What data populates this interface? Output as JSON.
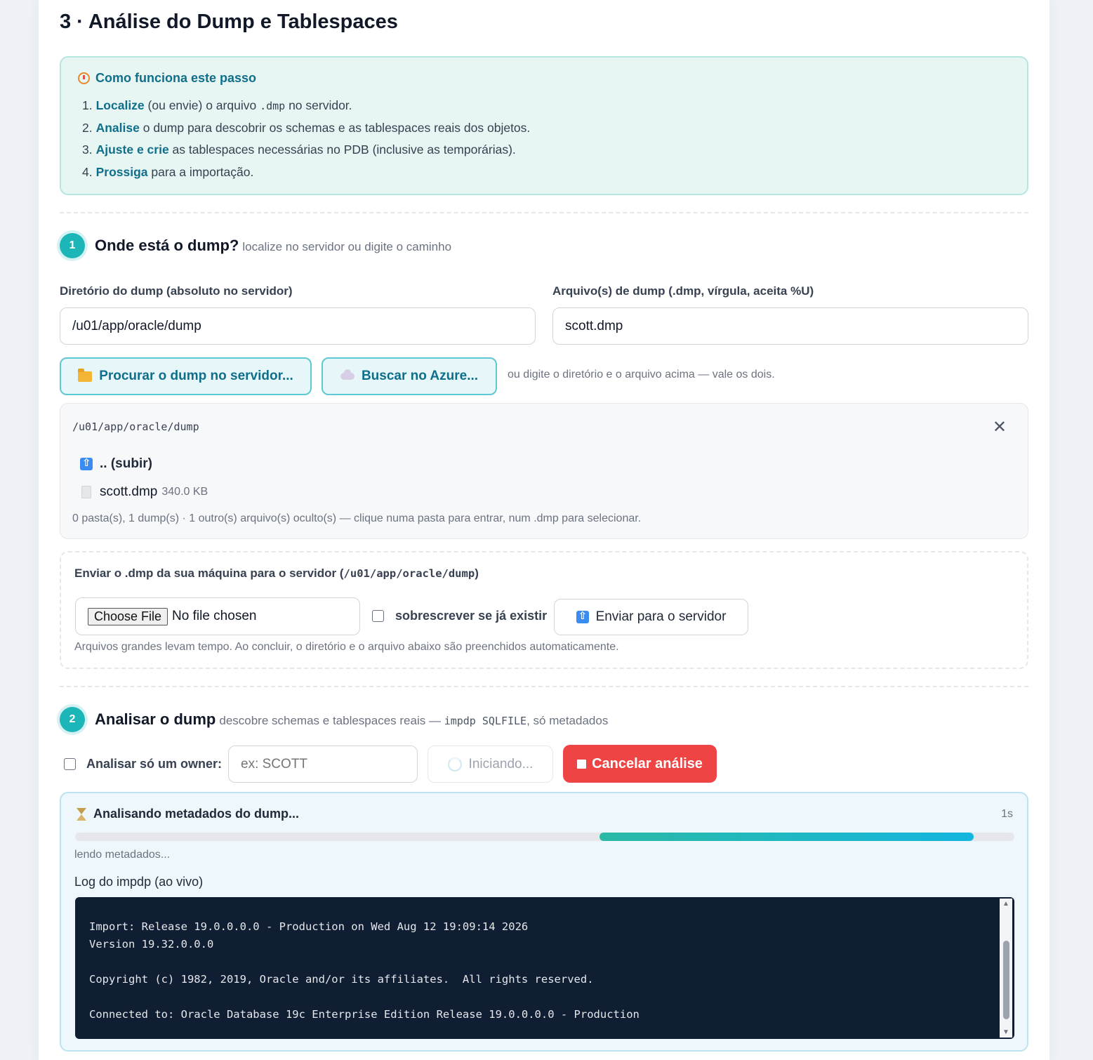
{
  "page": {
    "title": "3 · Análise do Dump e Tablespaces"
  },
  "info": {
    "title": "Como funciona este passo",
    "steps": [
      {
        "num": "1.",
        "keyword": "Localize",
        "text_a": " (ou envie) o arquivo ",
        "code": ".dmp",
        "text_b": " no servidor."
      },
      {
        "num": "2.",
        "keyword": "Analise",
        "text": " o dump para descobrir os schemas e as tablespaces reais dos objetos."
      },
      {
        "num": "3.",
        "keyword": "Ajuste e crie",
        "text": " as tablespaces necessárias no PDB (inclusive as temporárias)."
      },
      {
        "num": "4.",
        "keyword": "Prossiga",
        "text": " para a importação."
      }
    ]
  },
  "step1": {
    "badge": "1",
    "title": "Onde está o dump?",
    "subtitle": "localize no servidor ou digite o caminho",
    "dir_label": "Diretório do dump (absoluto no servidor)",
    "dir_value": "/u01/app/oracle/dump",
    "file_label": "Arquivo(s) de dump (.dmp, vírgula, aceita %U)",
    "file_value": "scott.dmp",
    "browse_label": "Procurar o dump no servidor...",
    "azure_label": "Buscar no Azure...",
    "hint": "ou digite o diretório e o arquivo acima — vale os dois."
  },
  "browser": {
    "path": "/u01/app/oracle/dump",
    "close": "✕",
    "up_label": ".. (subir)",
    "file_name": "scott.dmp",
    "file_size": "340.0 KB",
    "summary": "0 pasta(s), 1 dump(s) · 1 outro(s) arquivo(s) oculto(s) — clique numa pasta para entrar, num .dmp para selecionar."
  },
  "upload": {
    "title_prefix": "Enviar o .dmp da sua máquina para o servidor (",
    "title_path": "/u01/app/oracle/dump",
    "title_suffix": ")",
    "choose_label": "Choose File",
    "no_file": "No file chosen",
    "overwrite_label": "sobrescrever se já existir",
    "send_label": "Enviar para o servidor",
    "note": "Arquivos grandes levam tempo. Ao concluir, o diretório e o arquivo abaixo são preenchidos automaticamente."
  },
  "step2": {
    "badge": "2",
    "title": "Analisar o dump",
    "subtitle_a": "descobre schemas e tablespaces reais — ",
    "subtitle_code": "impdp SQLFILE",
    "subtitle_b": ", só metadados",
    "owner_label": "Analisar só um owner:",
    "owner_placeholder": "ex: SCOTT",
    "starting_label": "Iniciando...",
    "cancel_label": "Cancelar análise"
  },
  "progress": {
    "title": "Analisando metadados do dump...",
    "elapsed": "1s",
    "bar_start_fraction": 0.558,
    "bar_end_fraction": 0.957,
    "status": "lendo metadados...",
    "log_label": "Log do impdp (ao vivo)",
    "log_lines": [
      "Import: Release 19.0.0.0.0 - Production on Wed Aug 12 19:09:14 2026",
      "Version 19.32.0.0.0",
      "",
      "Copyright (c) 1982, 2019, Oracle and/or its affiliates.  All rights reserved.",
      "",
      "Connected to: Oracle Database 19c Enterprise Edition Release 19.0.0.0.0 - Production"
    ]
  }
}
